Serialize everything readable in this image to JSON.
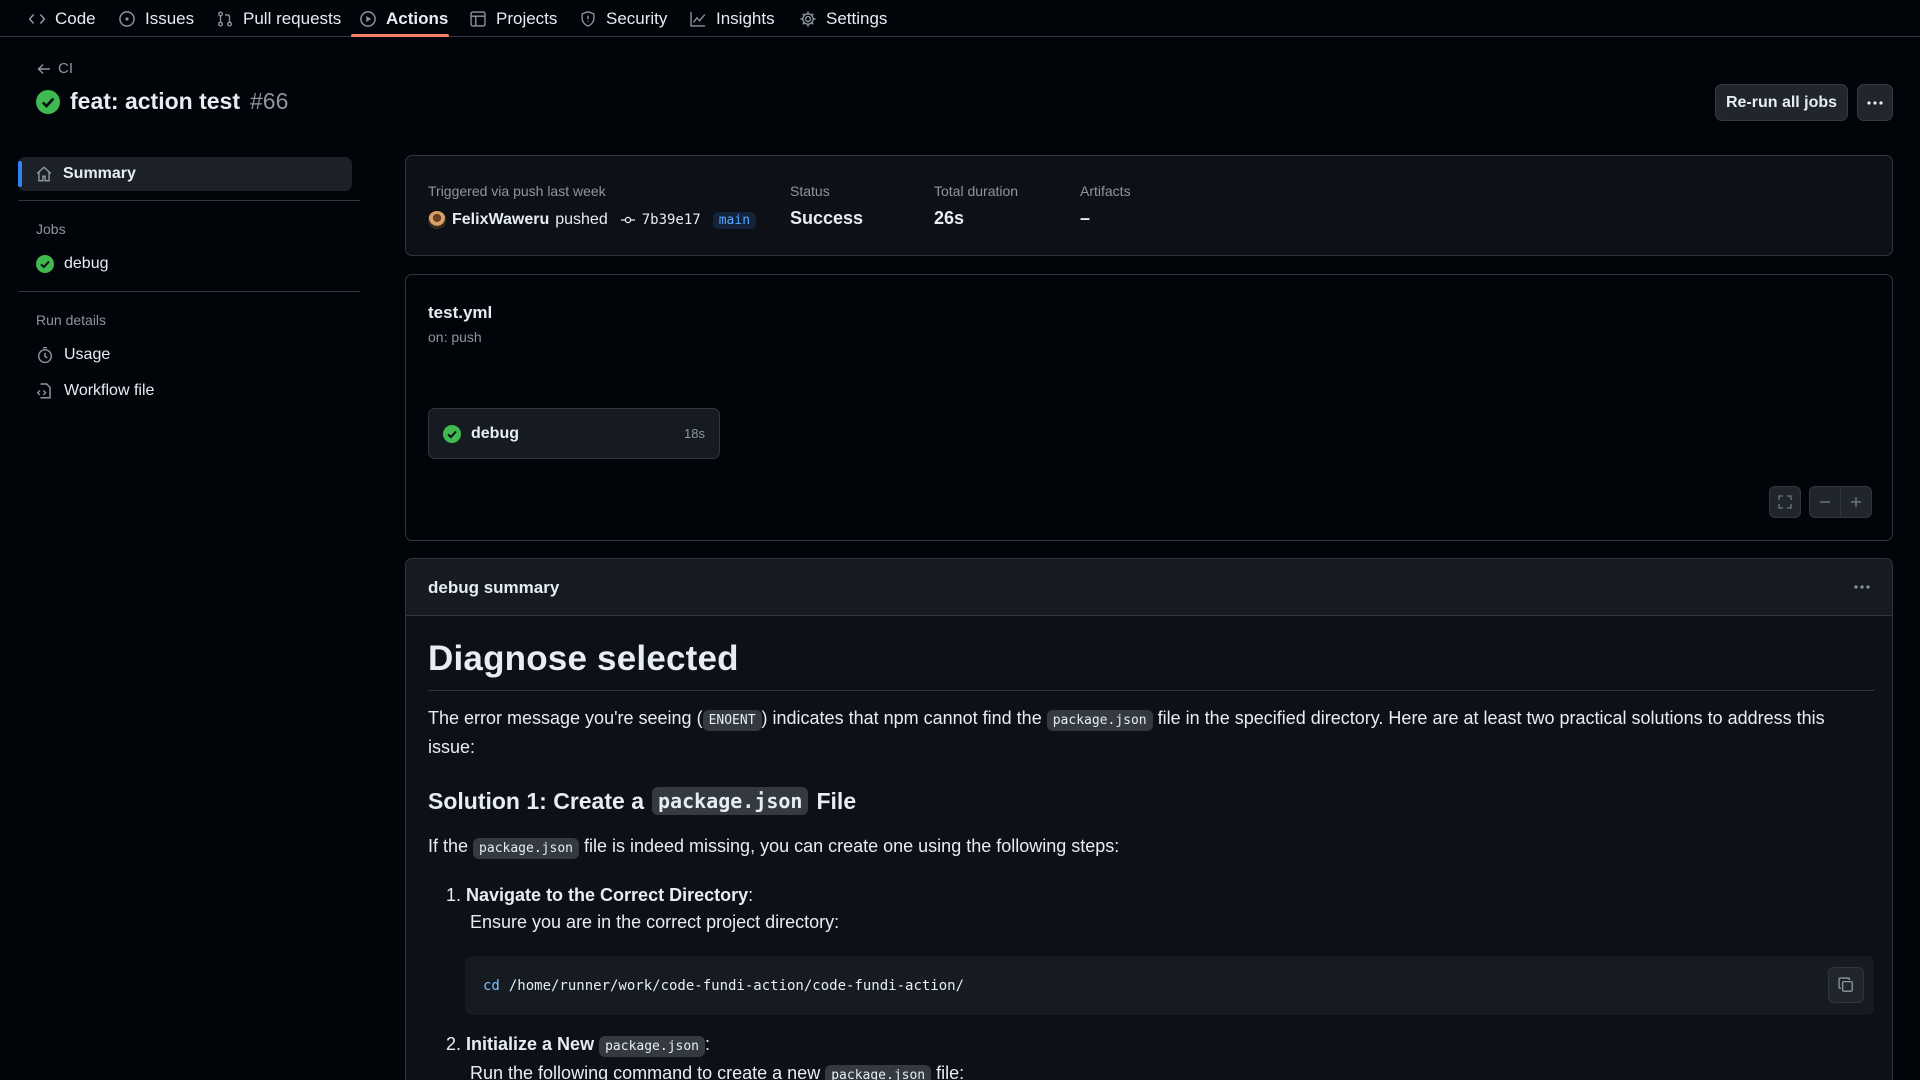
{
  "nav": {
    "tabs": [
      {
        "label": "Code",
        "icon": "code-icon"
      },
      {
        "label": "Issues",
        "icon": "issue-opened-icon"
      },
      {
        "label": "Pull requests",
        "icon": "git-pull-request-icon"
      },
      {
        "label": "Actions",
        "icon": "play-icon",
        "active": true
      },
      {
        "label": "Projects",
        "icon": "table-icon"
      },
      {
        "label": "Security",
        "icon": "shield-icon"
      },
      {
        "label": "Insights",
        "icon": "graph-icon"
      },
      {
        "label": "Settings",
        "icon": "gear-icon"
      }
    ]
  },
  "header": {
    "back_label": "CI",
    "title": "feat: action test",
    "run_number": "#66",
    "rerun_label": "Re-run all jobs"
  },
  "sidebar": {
    "summary_label": "Summary",
    "jobs_heading": "Jobs",
    "job_label": "debug",
    "run_details_heading": "Run details",
    "usage_label": "Usage",
    "workflow_file_label": "Workflow file"
  },
  "trigger": {
    "label": "Triggered via push last week",
    "author": "FelixWaweru",
    "action": "pushed",
    "commit": "7b39e17",
    "branch": "main",
    "status_label": "Status",
    "status_value": "Success",
    "duration_label": "Total duration",
    "duration_value": "26s",
    "artifacts_label": "Artifacts",
    "artifacts_value": "–"
  },
  "workflow": {
    "file": "test.yml",
    "on": "on: push",
    "job_name": "debug",
    "job_duration": "18s"
  },
  "summary": {
    "title": "debug summary",
    "h1": "Diagnose selected",
    "p1_a": "The error message you're seeing (",
    "p1_code1": "ENOENT",
    "p1_b": ") indicates that npm cannot find the",
    "p1_code2": "package.json",
    "p1_c": "file in the specified directory. Here are at least two practical solutions to address this issue:",
    "h3_a": "Solution 1: Create a",
    "h3_code": "package.json",
    "h3_b": "File",
    "p2_a": "If the",
    "p2_code": "package.json",
    "p2_b": "file is indeed missing, you can create one using the following steps:",
    "step1_num": "1.",
    "step1_bold": "Navigate to the Correct Directory",
    "step1_colon": ":",
    "step1_text": "Ensure you are in the correct project directory:",
    "code_cmd": "cd",
    "code_path": "/home/runner/work/code-fundi-action/code-fundi-action/",
    "step2_num": "2.",
    "step2_bold": "Initialize a New",
    "step2_code": "package.json",
    "step2_colon": ":",
    "step2_text_a": "Run the following command to create a new",
    "step2_code2": "package.json",
    "step2_text_b": "file:"
  },
  "colors": {
    "success": "#3fb950",
    "accent": "#2f81f7",
    "active_tab_underline": "#f78166"
  }
}
